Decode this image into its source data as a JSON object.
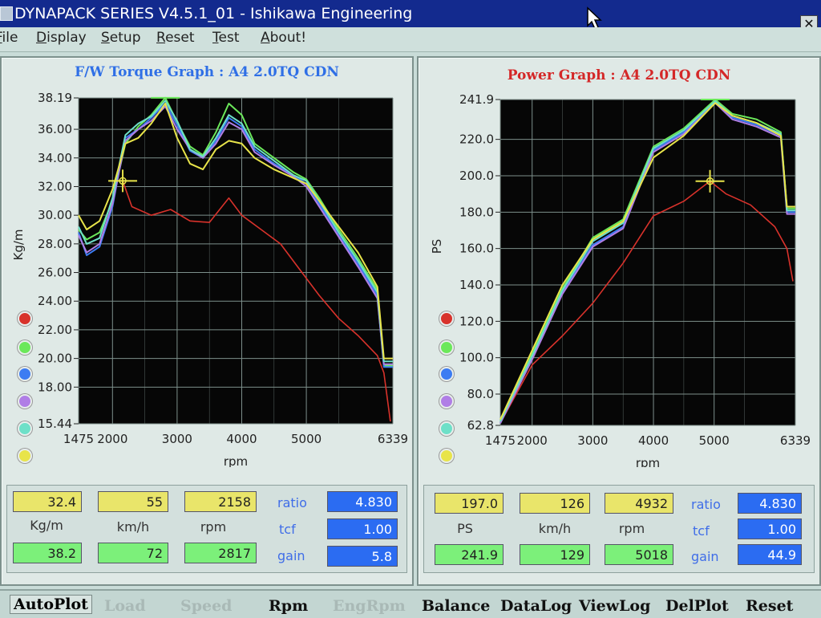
{
  "window": {
    "title": "DYNAPACK SERIES V4.5.1_01  - Ishikawa Engineering",
    "close_glyph": "✕"
  },
  "menu": [
    {
      "label": "File",
      "u": 0
    },
    {
      "label": "Display",
      "u": 0
    },
    {
      "label": "Setup",
      "u": 0
    },
    {
      "label": "Reset",
      "u": 0
    },
    {
      "label": "Test",
      "u": 0
    },
    {
      "label": "About!",
      "u": 0
    }
  ],
  "colors": {
    "plot_bg": "#060606",
    "grid": "#7d8f8b",
    "red": "#d8322b",
    "green": "#6be85a",
    "blue": "#3c7cf2",
    "purple": "#b07ee6",
    "cyan": "#6ee0c8",
    "yellow": "#e8e44a",
    "torque_title": "#2f6fe6",
    "power_title": "#d42828"
  },
  "legend": [
    {
      "name": "red-run-icon",
      "color": "#d8322b"
    },
    {
      "name": "green-run-icon",
      "color": "#6be85a"
    },
    {
      "name": "blue-run-icon",
      "color": "#3c7cf2"
    },
    {
      "name": "purple-run-icon",
      "color": "#b07ee6"
    },
    {
      "name": "cyan-run-icon",
      "color": "#6ee0c8"
    },
    {
      "name": "yellow-run-icon",
      "color": "#e8e44a"
    }
  ],
  "torque": {
    "title": "F/W Torque Graph : A4 2.0TQ CDN",
    "readouts": {
      "cursor_value": "32.4",
      "cursor_speed": "55",
      "cursor_rpm": "2158",
      "peak_value": "38.2",
      "peak_speed": "72",
      "peak_rpm": "2817",
      "unit_label": "Kg/m",
      "speed_label": "km/h",
      "rpm_label": "rpm",
      "ratio_label": "ratio",
      "ratio_value": "4.830",
      "tcf_label": "tcf",
      "tcf_value": "1.00",
      "gain_label": "gain",
      "gain_value": "5.8"
    }
  },
  "power": {
    "title": "Power Graph : A4 2.0TQ CDN",
    "readouts": {
      "cursor_value": "197.0",
      "cursor_speed": "126",
      "cursor_rpm": "4932",
      "peak_value": "241.9",
      "peak_speed": "129",
      "peak_rpm": "5018",
      "unit_label": "PS",
      "speed_label": "km/h",
      "rpm_label": "rpm",
      "ratio_label": "ratio",
      "ratio_value": "4.830",
      "tcf_label": "tcf",
      "tcf_value": "1.00",
      "gain_label": "gain",
      "gain_value": "44.9"
    }
  },
  "bottom_buttons": [
    {
      "label": "AutoPlot",
      "state": "first"
    },
    {
      "label": "Load",
      "state": "disabled"
    },
    {
      "label": "Speed",
      "state": "disabled"
    },
    {
      "label": "Rpm",
      "state": "active"
    },
    {
      "label": "EngRpm",
      "state": "disabled"
    },
    {
      "label": "Balance",
      "state": "active"
    },
    {
      "label": "DataLog",
      "state": "active"
    },
    {
      "label": "ViewLog",
      "state": "active"
    },
    {
      "label": "DelPlot",
      "state": "active"
    },
    {
      "label": "Reset",
      "state": "active"
    }
  ],
  "chart_data": [
    {
      "type": "line",
      "title": "F/W Torque Graph : A4 2.0TQ CDN",
      "xlabel": "rpm",
      "ylabel": "Kg/m",
      "xlim": [
        1475,
        6339
      ],
      "ylim": [
        15.44,
        38.19
      ],
      "xticks": [
        1475,
        2000,
        3000,
        4000,
        5000,
        6339
      ],
      "yticks": [
        15.44,
        18.0,
        20.0,
        22.0,
        24.0,
        26.0,
        28.0,
        30.0,
        32.0,
        34.0,
        36.0,
        38.19
      ],
      "ytick_labels": [
        "15.44",
        "18.00",
        "20.00",
        "22.00",
        "24.00",
        "26.00",
        "28.00",
        "30.00",
        "32.00",
        "34.00",
        "36.00",
        "38.19"
      ],
      "grid": true,
      "cursor": {
        "x": 2158,
        "y": 32.4
      },
      "peak_marker": {
        "x": 2817,
        "y": 38.2
      },
      "series": [
        {
          "color_key": "red",
          "x": [
            2158,
            2300,
            2600,
            2900,
            3200,
            3500,
            3800,
            4000,
            4300,
            4600,
            4900,
            5200,
            5500,
            5800,
            6100,
            6200,
            6300
          ],
          "y": [
            32.4,
            30.6,
            30.0,
            30.4,
            29.6,
            29.5,
            31.2,
            30.0,
            29.0,
            28.0,
            26.2,
            24.4,
            22.8,
            21.6,
            20.2,
            19.0,
            15.6
          ]
        },
        {
          "color_key": "green",
          "x": [
            1475,
            1600,
            1800,
            2000,
            2200,
            2400,
            2600,
            2817,
            3000,
            3200,
            3400,
            3600,
            3800,
            4000,
            4200,
            4500,
            4800,
            5000,
            5200,
            5500,
            5800,
            6100,
            6200,
            6339
          ],
          "y": [
            29.0,
            28.3,
            28.8,
            31.0,
            35.0,
            36.2,
            37.0,
            38.2,
            36.5,
            34.8,
            34.2,
            35.8,
            37.8,
            37.0,
            35.0,
            34.0,
            33.0,
            32.5,
            31.2,
            29.0,
            27.0,
            24.8,
            19.5,
            19.5
          ]
        },
        {
          "color_key": "blue",
          "x": [
            1475,
            1600,
            1800,
            2000,
            2200,
            2400,
            2600,
            2817,
            3000,
            3200,
            3400,
            3600,
            3800,
            4000,
            4200,
            4500,
            4800,
            5000,
            5200,
            5500,
            5800,
            6100,
            6200,
            6339
          ],
          "y": [
            28.8,
            27.2,
            27.8,
            30.6,
            35.4,
            36.0,
            36.8,
            37.8,
            36.3,
            34.5,
            34.0,
            35.2,
            36.8,
            36.2,
            34.6,
            33.6,
            32.8,
            32.2,
            30.8,
            28.6,
            26.6,
            24.4,
            19.4,
            19.4
          ]
        },
        {
          "color_key": "purple",
          "x": [
            1475,
            1600,
            1800,
            2000,
            2200,
            2400,
            2600,
            2817,
            3000,
            3200,
            3400,
            3600,
            3800,
            4000,
            4200,
            4500,
            4800,
            5000,
            5200,
            5500,
            5800,
            6100,
            6200,
            6339
          ],
          "y": [
            28.6,
            27.4,
            28.0,
            30.8,
            35.2,
            36.0,
            36.6,
            37.6,
            36.0,
            34.6,
            34.0,
            35.0,
            36.5,
            36.0,
            34.4,
            33.5,
            32.7,
            32.0,
            30.6,
            28.5,
            26.4,
            24.2,
            19.6,
            19.6
          ]
        },
        {
          "color_key": "cyan",
          "x": [
            1475,
            1600,
            1800,
            2000,
            2200,
            2400,
            2600,
            2817,
            3000,
            3200,
            3400,
            3600,
            3800,
            4000,
            4200,
            4500,
            4800,
            5000,
            5200,
            5500,
            5800,
            6100,
            6200,
            6339
          ],
          "y": [
            29.2,
            28.0,
            28.4,
            31.2,
            35.6,
            36.4,
            36.9,
            38.0,
            36.6,
            34.6,
            34.1,
            35.4,
            37.0,
            36.4,
            34.8,
            33.8,
            32.8,
            32.4,
            31.0,
            28.8,
            26.8,
            24.6,
            19.8,
            19.8
          ]
        },
        {
          "color_key": "yellow",
          "x": [
            1475,
            1600,
            1800,
            2000,
            2200,
            2400,
            2600,
            2817,
            3000,
            3200,
            3400,
            3600,
            3800,
            4000,
            4200,
            4500,
            4800,
            5000,
            5200,
            5500,
            5800,
            6100,
            6200,
            6339
          ],
          "y": [
            30.0,
            29.0,
            29.6,
            31.8,
            35.0,
            35.4,
            36.4,
            37.8,
            35.4,
            33.6,
            33.2,
            34.6,
            35.2,
            35.0,
            34.0,
            33.2,
            32.6,
            32.2,
            31.0,
            29.2,
            27.4,
            25.0,
            20.0,
            20.0
          ]
        }
      ]
    },
    {
      "type": "line",
      "title": "Power Graph : A4 2.0TQ CDN",
      "xlabel": "rpm",
      "ylabel": "PS",
      "xlim": [
        1475,
        6339
      ],
      "ylim": [
        62.8,
        241.9
      ],
      "xticks": [
        1475,
        2000,
        3000,
        4000,
        5000,
        6339
      ],
      "yticks": [
        62.8,
        80.0,
        100.0,
        120.0,
        140.0,
        160.0,
        180.0,
        200.0,
        220.0,
        241.9
      ],
      "ytick_labels": [
        "62.8",
        "80.0",
        "100.0",
        "120.0",
        "140.0",
        "160.0",
        "180.0",
        "200.0",
        "220.0",
        "241.9"
      ],
      "grid": true,
      "cursor": {
        "x": 4932,
        "y": 197.0
      },
      "peak_marker": {
        "x": 5018,
        "y": 241.9
      },
      "series": [
        {
          "color_key": "red",
          "x": [
            1475,
            2000,
            2500,
            3000,
            3500,
            4000,
            4500,
            4932,
            5200,
            5600,
            6000,
            6200,
            6300
          ],
          "y": [
            64,
            96,
            112,
            130,
            152,
            178,
            186,
            197,
            190,
            184,
            172,
            160,
            142
          ]
        },
        {
          "color_key": "green",
          "x": [
            1475,
            2000,
            2500,
            3000,
            3500,
            4000,
            4500,
            5018,
            5300,
            5700,
            6100,
            6200,
            6339
          ],
          "y": [
            65,
            102,
            138,
            166,
            176,
            216,
            226,
            241.9,
            234,
            231,
            224,
            182,
            182
          ]
        },
        {
          "color_key": "blue",
          "x": [
            1475,
            2000,
            2500,
            3000,
            3500,
            4000,
            4500,
            5018,
            5300,
            5700,
            6100,
            6200,
            6339
          ],
          "y": [
            64,
            100,
            136,
            162,
            172,
            214,
            224,
            240.5,
            232,
            228,
            222,
            180,
            180
          ]
        },
        {
          "color_key": "purple",
          "x": [
            1475,
            2000,
            2500,
            3000,
            3500,
            4000,
            4500,
            5018,
            5300,
            5700,
            6100,
            6200,
            6339
          ],
          "y": [
            64,
            99,
            135,
            161,
            171,
            213,
            223,
            240.0,
            231,
            227,
            221,
            179,
            179
          ]
        },
        {
          "color_key": "cyan",
          "x": [
            1475,
            2000,
            2500,
            3000,
            3500,
            4000,
            4500,
            5018,
            5300,
            5700,
            6100,
            6200,
            6339
          ],
          "y": [
            65,
            101,
            137,
            164,
            174,
            215,
            225,
            241.0,
            233,
            229,
            223,
            181,
            181
          ]
        },
        {
          "color_key": "yellow",
          "x": [
            1475,
            2000,
            2500,
            3000,
            3500,
            4000,
            4500,
            5018,
            5300,
            5700,
            6100,
            6200,
            6339
          ],
          "y": [
            66,
            104,
            140,
            165,
            175,
            210,
            222,
            240.0,
            233,
            229,
            222,
            183,
            183
          ]
        }
      ]
    }
  ]
}
